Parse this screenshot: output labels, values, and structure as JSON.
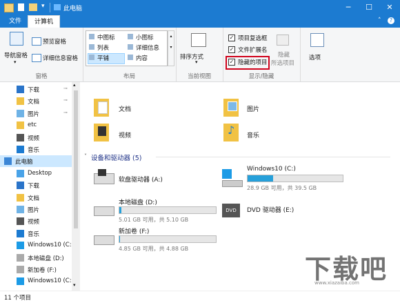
{
  "window": {
    "title": "此电脑",
    "controls": {
      "minimize": "─",
      "maximize": "☐",
      "close": "✕"
    }
  },
  "ribbon_tabs": [
    {
      "label": "文件"
    },
    {
      "label": "计算机"
    }
  ],
  "ribbon": {
    "pane_group": {
      "nav_pane": "导航窗格",
      "preview_pane": "预览窗格",
      "details_pane": "详细信息窗格",
      "label": "窗格"
    },
    "layout_group": {
      "items": [
        "中图标",
        "小图标",
        "列表",
        "详细信息",
        "平铺",
        "内容"
      ],
      "label": "布局"
    },
    "current_view_group": {
      "sort": "排序方式",
      "label": "当前视图"
    },
    "show_hide_group": {
      "checkboxes": [
        {
          "label": "项目复选框",
          "checked": true
        },
        {
          "label": "文件扩展名",
          "checked": true
        },
        {
          "label": "隐藏的项目",
          "checked": true
        }
      ],
      "hide_selected_line1": "隐藏",
      "hide_selected_line2": "所选项目",
      "label": "显示/隐藏"
    },
    "options": "选项"
  },
  "nav": {
    "items": [
      {
        "label": "下载",
        "icon": "download-icon",
        "pinned": true
      },
      {
        "label": "文档",
        "icon": "document-icon",
        "pinned": true
      },
      {
        "label": "图片",
        "icon": "picture-icon",
        "pinned": true
      },
      {
        "label": "etc",
        "icon": "folder-icon"
      },
      {
        "label": "视频",
        "icon": "video-icon"
      },
      {
        "label": "音乐",
        "icon": "music-icon"
      },
      {
        "label": "此电脑",
        "icon": "computer-icon",
        "selected": true
      },
      {
        "label": "Desktop",
        "icon": "desktop-icon"
      },
      {
        "label": "下载",
        "icon": "download-icon"
      },
      {
        "label": "文档",
        "icon": "document-icon"
      },
      {
        "label": "图片",
        "icon": "picture-icon"
      },
      {
        "label": "视频",
        "icon": "video-icon"
      },
      {
        "label": "音乐",
        "icon": "music-icon"
      },
      {
        "label": "Windows10 (C:",
        "icon": "windows-drive-icon"
      },
      {
        "label": "本地磁盘 (D:)",
        "icon": "drive-icon"
      },
      {
        "label": "新加卷 (F:)",
        "icon": "drive-icon"
      },
      {
        "label": "Windows10 (C:",
        "icon": "windows-drive-icon"
      }
    ]
  },
  "folders": [
    {
      "label": "文档"
    },
    {
      "label": "图片"
    },
    {
      "label": "视频"
    },
    {
      "label": "音乐"
    }
  ],
  "devices_header": "设备和驱动器 (5)",
  "drives": [
    {
      "name": "软盘驱动器 (A:)"
    },
    {
      "name": "Windows10 (C:)",
      "usage": "28.9 GB 可用，共 39.5 GB",
      "used_fraction": 0.27
    },
    {
      "name": "本地磁盘 (D:)",
      "usage": "5.01 GB 可用，共 5.10 GB",
      "used_fraction": 0.02
    },
    {
      "name": "DVD 驱动器 (E:)"
    },
    {
      "name": "新加卷 (F:)",
      "usage": "4.85 GB 可用，共 4.88 GB",
      "used_fraction": 0.01
    }
  ],
  "status": {
    "count": "11 个项目"
  },
  "watermark": {
    "text": "下载吧",
    "url": "www.xiazaiba.com"
  },
  "colors": {
    "accent": "#1c7bd1",
    "highlight_box": "#d0021b",
    "bar_fill": "#26a0da",
    "folder": "#f1c244"
  }
}
